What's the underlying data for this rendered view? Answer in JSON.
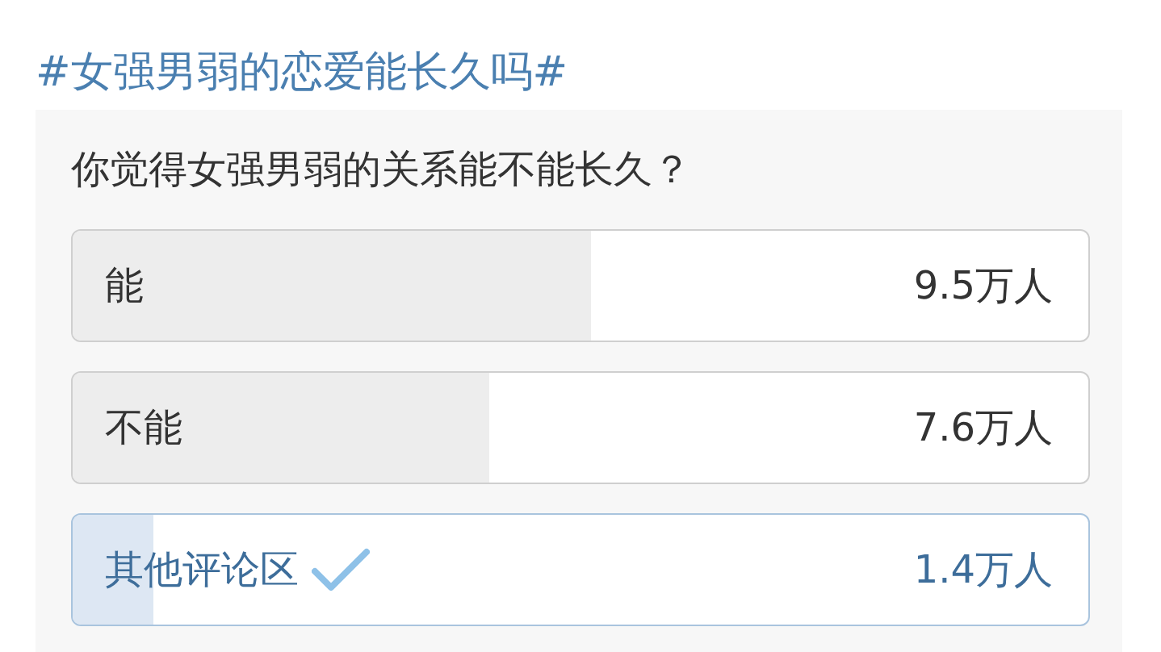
{
  "topic": "#女强男弱的恋爱能长久吗#",
  "poll": {
    "question": "你觉得女强男弱的关系能不能长久？",
    "options": [
      {
        "label": "能",
        "count": "9.5万人",
        "level": 0.51,
        "selected": false
      },
      {
        "label": "不能",
        "count": "7.6万人",
        "level": 0.41,
        "selected": false
      },
      {
        "label": "其他评论区",
        "count": "1.4万人",
        "level": 0.08,
        "selected": true
      }
    ]
  }
}
